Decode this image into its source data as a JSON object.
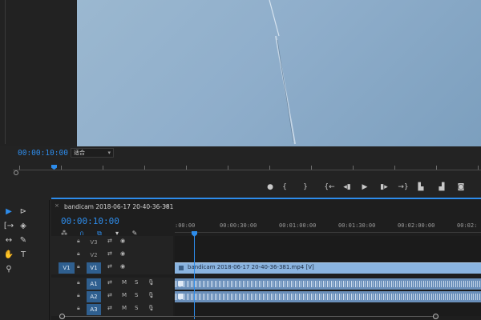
{
  "monitor": {
    "timecode": "00:00:10:00",
    "fit_select": "适合",
    "transport_buttons": [
      {
        "icon": "marker-icon",
        "glyph": "●"
      },
      {
        "icon": "mark-in-icon",
        "glyph": "{"
      },
      {
        "icon": "mark-out-icon",
        "glyph": "}"
      },
      {
        "icon": "go-to-in-icon",
        "glyph": "{←"
      },
      {
        "icon": "step-back-icon",
        "glyph": "◂▮"
      },
      {
        "icon": "play-icon",
        "glyph": "▶"
      },
      {
        "icon": "step-forward-icon",
        "glyph": "▮▸"
      },
      {
        "icon": "go-to-out-icon",
        "glyph": "→}"
      },
      {
        "icon": "lift-icon",
        "glyph": "▙"
      },
      {
        "icon": "extract-icon",
        "glyph": "▟"
      },
      {
        "icon": "export-frame-icon",
        "glyph": "◙"
      }
    ]
  },
  "tools": [
    {
      "icon": "selection-tool-icon",
      "glyph": "▶",
      "active": true
    },
    {
      "icon": "track-select-tool-icon",
      "glyph": "⊳"
    },
    {
      "icon": "ripple-edit-tool-icon",
      "glyph": "[→"
    },
    {
      "icon": "razor-tool-icon",
      "glyph": "◈"
    },
    {
      "icon": "slip-tool-icon",
      "glyph": "↔"
    },
    {
      "icon": "pen-tool-icon",
      "glyph": "✎"
    },
    {
      "icon": "hand-tool-icon",
      "glyph": "✋"
    },
    {
      "icon": "type-tool-icon",
      "glyph": "T"
    },
    {
      "icon": "zoom-tool-icon",
      "glyph": "⚲"
    }
  ],
  "timeline": {
    "sequence_name": "bandicam 2018-06-17 20-40-36-381",
    "close_glyph": "×",
    "menu_glyph": "≡",
    "timecode": "00:00:10:00",
    "ruler_labels": [
      ":00:00",
      "00:00:30:00",
      "00:01:00:00",
      "00:01:30:00",
      "00:02:00:00",
      "00:02:"
    ],
    "tracks": [
      {
        "name": "V3",
        "type": "video",
        "source": ""
      },
      {
        "name": "V2",
        "type": "video",
        "source": ""
      },
      {
        "name": "V1",
        "type": "video",
        "source": "V1"
      },
      {
        "name": "A1",
        "type": "audio",
        "source": ""
      },
      {
        "name": "A2",
        "type": "audio",
        "source": ""
      },
      {
        "name": "A3",
        "type": "audio",
        "source": ""
      }
    ],
    "video_clip_label": "bandicam 2018-06-17 20-40-36-381.mp4 [V]",
    "mute_label": "M",
    "solo_label": "S"
  }
}
